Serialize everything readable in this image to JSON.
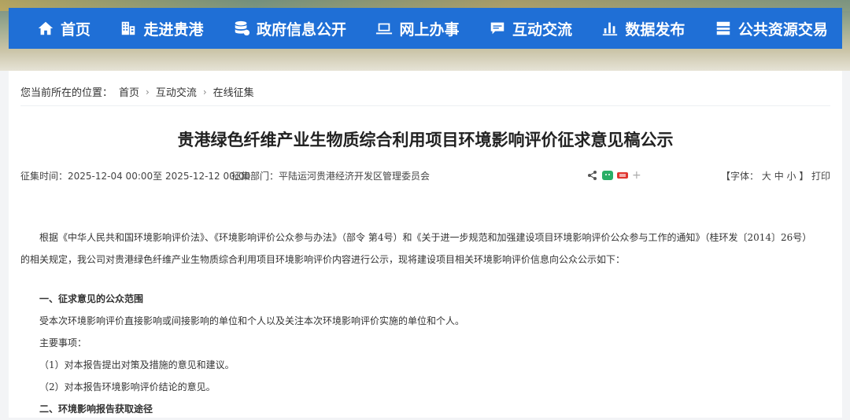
{
  "nav": {
    "items": [
      {
        "label": "首页",
        "icon": "home-icon"
      },
      {
        "label": "走进贵港",
        "icon": "building-icon"
      },
      {
        "label": "政府信息公开",
        "icon": "database-icon"
      },
      {
        "label": "网上办事",
        "icon": "laptop-icon"
      },
      {
        "label": "互动交流",
        "icon": "chat-icon"
      },
      {
        "label": "数据发布",
        "icon": "bar-chart-icon"
      },
      {
        "label": "公共资源交易",
        "icon": "server-icon"
      }
    ]
  },
  "breadcrumb": {
    "prefix": "您当前所在的位置：",
    "items": [
      "首页",
      "互动交流",
      "在线征集"
    ]
  },
  "article": {
    "title": "贵港绿色纤维产业生物质综合利用项目环境影响评价征求意见稿公示",
    "time": "征集时间：2025-12-04 00:00至 2025-12-12 00:00",
    "dept": "征集部门：平陆运河贵港经济开发区管理委员会",
    "font_label_open": "【字体：",
    "font_large": "大",
    "font_medium": "中",
    "font_small": "小",
    "font_label_close": "】",
    "print": "打印",
    "para1_line1": "根据《中华人民共和国环境影响评价法》、《环境影响评价公众参与办法》（部令 第4号）和《关于进一步规范和加强建设项目环境影响评价公众参与工作的通知》（桂环发〔2014〕26号）",
    "para1_line2": "的相关规定，我公司对贵港绿色纤维产业生物质综合利用项目环境影响评价内容进行公示，现将建设项目相关环境影响评价信息向公众公示如下：",
    "section1": "一、征求意见的公众范围",
    "s1_text": "受本次环境影响评价直接影响或间接影响的单位和个人以及关注本次环境影响评价实施的单位和个人。",
    "s1_sub": "主要事项：",
    "s1_item1": "（1）对本报告提出对策及措施的意见和建议。",
    "s1_item2": "（2）对本报告环境影响评价结论的意见。",
    "section2": "二、环境影响报告获取途径"
  },
  "colors": {
    "nav_bg": "#1f6fd6",
    "wechat": "#2aae67",
    "weibo": "#e0342e"
  }
}
